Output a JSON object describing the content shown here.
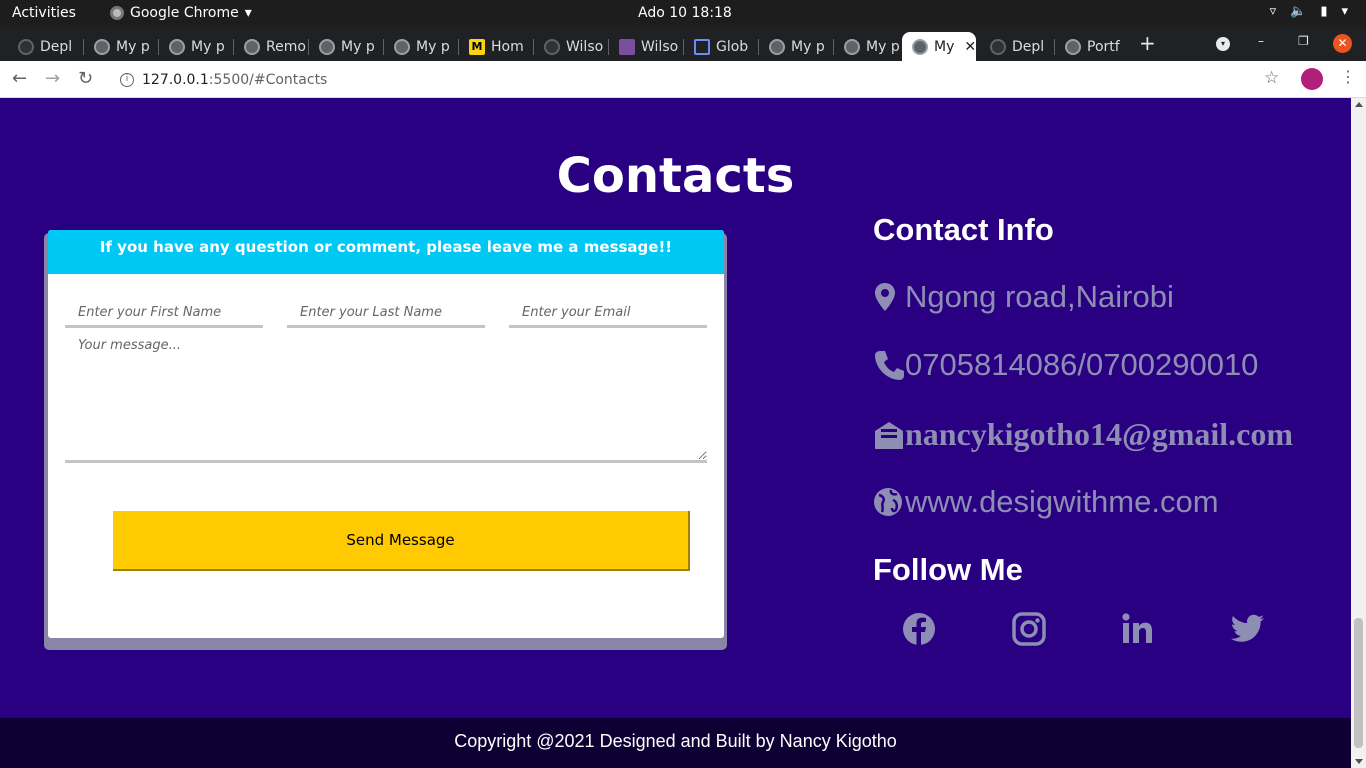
{
  "system_bar": {
    "activities": "Activities",
    "app_menu": "Google Chrome",
    "clock": "Ado 10  18:18"
  },
  "tabs": [
    {
      "label": "Depl",
      "icon": "github-icon"
    },
    {
      "label": "My p",
      "icon": "globe-icon"
    },
    {
      "label": "My p",
      "icon": "globe-icon"
    },
    {
      "label": "Remo",
      "icon": "layers-icon"
    },
    {
      "label": "My p",
      "icon": "globe-icon"
    },
    {
      "label": "My p",
      "icon": "globe-icon"
    },
    {
      "label": "Hom",
      "icon": "m-logo-icon"
    },
    {
      "label": "Wilso",
      "icon": "github-icon"
    },
    {
      "label": "Wilso",
      "icon": "image-icon"
    },
    {
      "label": "Glob",
      "icon": "flag-icon"
    },
    {
      "label": "My p",
      "icon": "globe-icon"
    },
    {
      "label": "My p",
      "icon": "globe-icon"
    },
    {
      "label": "My",
      "icon": "globe-icon",
      "active": true
    },
    {
      "label": "Depl",
      "icon": "github-icon"
    },
    {
      "label": "Portf",
      "icon": "globe-icon"
    }
  ],
  "toolbar": {
    "url_host": "127.0.0.1",
    "url_rest": ":5500/#Contacts"
  },
  "page": {
    "section_title": "Contacts",
    "form": {
      "header": "If you have any question or comment, please leave me a message!!",
      "first_name_placeholder": "Enter your First Name",
      "last_name_placeholder": "Enter your Last Name",
      "email_placeholder": "Enter your Email",
      "message_placeholder": "Your message...",
      "submit_label": "Send Message"
    },
    "contact_info": {
      "heading": "Contact Info",
      "location": "Ngong road,Nairobi",
      "phone": "0705814086/0700290010",
      "email": "nancykigotho14@gmail.com",
      "website": "www.desigwithme.com"
    },
    "follow": {
      "heading": "Follow Me",
      "networks": [
        "facebook",
        "instagram",
        "linkedin",
        "twitter"
      ]
    },
    "footer": "Copyright @2021 Designed and Built by Nancy Kigotho"
  },
  "colors": {
    "page_bg": "#280081",
    "form_header": "#00c8f4",
    "button": "#ffca00",
    "info_text": "#8e8eb4",
    "footer_bg": "#0e0033"
  }
}
